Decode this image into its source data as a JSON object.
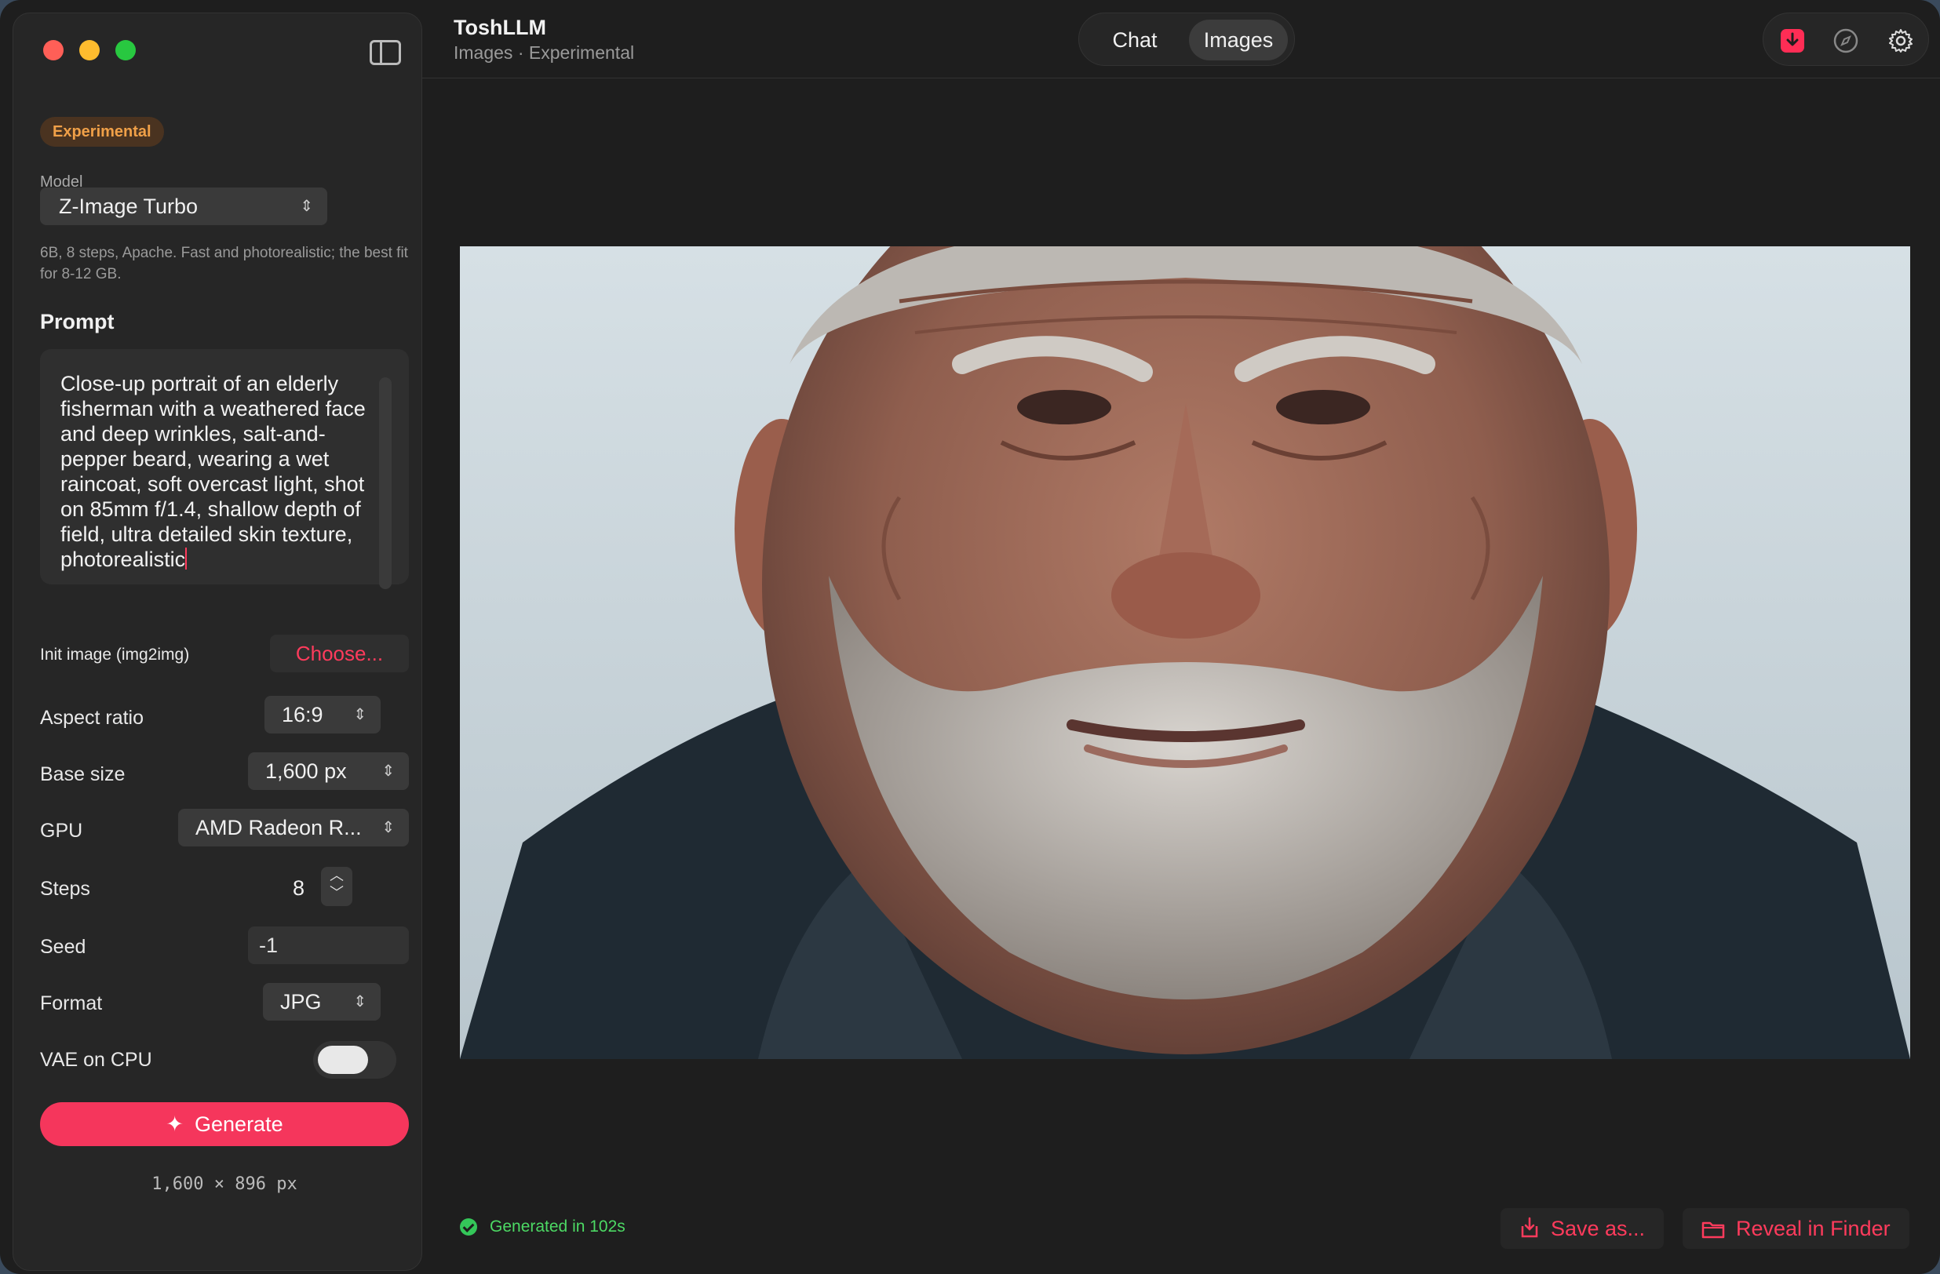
{
  "sidebar": {
    "badge": "Experimental",
    "model_label": "Model",
    "model_value": "Z-Image Turbo",
    "model_desc": "6B, 8 steps, Apache. Fast and photorealistic; the best fit for 8-12 GB.",
    "prompt_heading": "Prompt",
    "prompt_text": "Close-up portrait of an elderly fisherman with a weathered face and deep wrinkles, salt-and-pepper beard, wearing a wet raincoat, soft overcast light, shot on 85mm f/1.4, shallow depth of field, ultra detailed skin texture, photorealistic",
    "init_image_label": "Init image (img2img)",
    "choose_label": "Choose...",
    "aspect_label": "Aspect ratio",
    "aspect_value": "16:9",
    "base_size_label": "Base size",
    "base_size_value": "1,600 px",
    "gpu_label": "GPU",
    "gpu_value": "AMD Radeon R...",
    "steps_label": "Steps",
    "steps_value": "8",
    "seed_label": "Seed",
    "seed_value": "-1",
    "format_label": "Format",
    "format_value": "JPG",
    "vae_label": "VAE on CPU",
    "vae_on": false,
    "generate_label": "Generate",
    "dimensions": "1,600 × 896 px"
  },
  "header": {
    "title": "ToshLLM",
    "subtitle": "Images · Experimental",
    "tabs": [
      "Chat",
      "Images"
    ],
    "active_tab": "Images",
    "icons": [
      "download-icon",
      "compass-icon",
      "gear-icon"
    ]
  },
  "main": {
    "image_alt": "Generated portrait",
    "status": "Generated in 102s",
    "save_label": "Save as...",
    "reveal_label": "Reveal in Finder"
  },
  "colors": {
    "accent": "#f5365c",
    "badge_text": "#f0a048",
    "success": "#4cd964"
  }
}
